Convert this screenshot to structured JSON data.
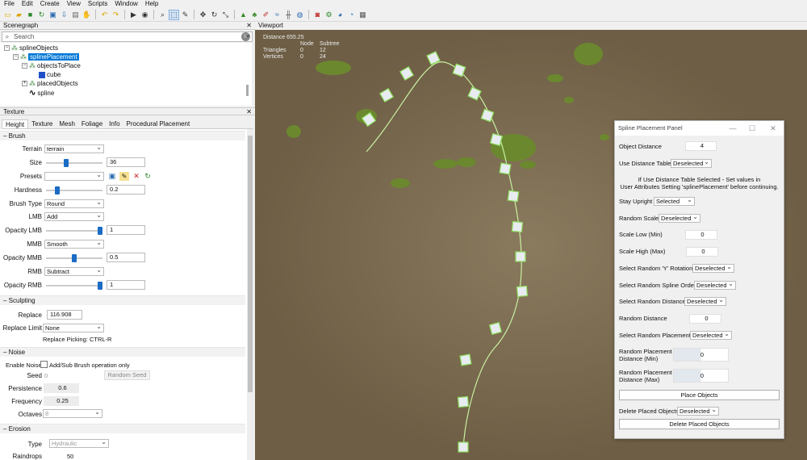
{
  "menu": [
    "File",
    "Edit",
    "Create",
    "View",
    "Scripts",
    "Window",
    "Help"
  ],
  "toolbar_icons": [
    "new-icon",
    "open-icon",
    "save-icon",
    "refresh-icon",
    "save-as-icon",
    "import-icon",
    "clipboard-icon",
    "hand-icon",
    "undo-icon",
    "redo-icon",
    "play-icon",
    "eye-icon",
    "zoom-icon",
    "select-icon",
    "paint-icon",
    "move-icon",
    "rotate-icon",
    "scale-icon",
    "terrain-icon",
    "tree-icon",
    "brush-icon",
    "water-icon",
    "road-icon",
    "globe-icon",
    "camera-icon",
    "gear-icon",
    "earth-icon",
    "snapshot-icon"
  ],
  "scenegraph": {
    "title": "Scenegraph",
    "search_placeholder": "Search",
    "nodes": {
      "root": "splineObjects",
      "placement": "splinePlacement",
      "objects_to_place": "objectsToPlace",
      "cube": "cube",
      "placed": "placedObjects",
      "spline": "spline"
    }
  },
  "texture": {
    "title": "Texture",
    "tabs": [
      "Height",
      "Texture",
      "Mesh",
      "Foliage",
      "Info",
      "Procedural Placement"
    ],
    "brush": {
      "heading": "Brush",
      "terrain_label": "Terrain",
      "terrain_value": "terrain",
      "size_label": "Size",
      "size_value": "36",
      "size_level": 0.35,
      "presets_label": "Presets",
      "hardness_label": "Hardness",
      "hardness_value": "0.2",
      "hardness_level": 0.2,
      "brush_type_label": "Brush Type",
      "brush_type_value": "Round",
      "lmb_label": "LMB",
      "lmb_value": "Add",
      "opacity_lmb_label": "Opacity LMB",
      "opacity_lmb_value": "1",
      "opacity_lmb_level": 1,
      "mmb_label": "MMB",
      "mmb_value": "Smooth",
      "opacity_mmb_label": "Opacity MMB",
      "opacity_mmb_value": "0.5",
      "opacity_mmb_level": 0.5,
      "rmb_label": "RMB",
      "rmb_value": "Subtract",
      "opacity_rmb_label": "Opacity RMB",
      "opacity_rmb_value": "1",
      "opacity_rmb_level": 1
    },
    "sculpting": {
      "heading": "Sculpting",
      "replace_label": "Replace",
      "replace_value": "116.908",
      "replace_limit_label": "Replace Limit",
      "replace_limit_value": "None",
      "picking_hint": "Replace Picking: CTRL-R"
    },
    "noise": {
      "heading": "Noise",
      "enable_label": "Enable Noise",
      "checkbox_label": "Add/Sub Brush operation only",
      "seed_label": "Seed",
      "seed_value": "0",
      "random_seed_button": "Random Seed",
      "persistence_label": "Persistence",
      "persistence_value": "0.6",
      "frequency_label": "Frequency",
      "frequency_value": "0.25",
      "octaves_label": "Octaves",
      "octaves_value": "8"
    },
    "erosion": {
      "heading": "Erosion",
      "type_label": "Type",
      "type_value": "Hydraulic",
      "raindrops_label": "Raindrops",
      "raindrops_value": "50"
    }
  },
  "viewport": {
    "title": "Viewport",
    "distance": "Distance 655.25",
    "col_node": "Node",
    "col_subtree": "Subtree",
    "triangles_label": "Triangles",
    "triangles_node": "0",
    "triangles_subtree": "12",
    "vertices_label": "Vertices",
    "vertices_node": "0",
    "vertices_subtree": "24"
  },
  "panel": {
    "title": "Spline Placement Panel",
    "object_distance_label": "Object Distance",
    "object_distance_value": "4",
    "use_distance_table_label": "Use Distance Table",
    "use_distance_table_value": "Deselected",
    "note_line1": "If Use Distance Table Selected - Set values in",
    "note_line2": "User Attributes Setting 'splinePlacement' before continuing.",
    "stay_upright_label": "Stay Upright",
    "stay_upright_value": "Selected",
    "random_scale_label": "Random Scale",
    "random_scale_value": "Deselected",
    "scale_low_label": "Scale Low (Min)",
    "scale_low_value": "0",
    "scale_high_label": "Scale High (Max)",
    "scale_high_value": "0",
    "random_y_label": "Select Random 'Y' Rotation",
    "random_y_value": "Deselected",
    "random_order_label": "Select Random Spline Order",
    "random_order_value": "Deselected",
    "random_distance_sel_label": "Select Random Distance",
    "random_distance_sel_value": "Deselected",
    "random_distance_label": "Random Distance",
    "random_distance_value": "0",
    "random_placement_label": "Select Random Placement",
    "random_placement_value": "Deselected",
    "rp_min_label1": "Random Placement",
    "rp_min_label2": "Distance (Min)",
    "rp_min_value": "0",
    "rp_max_label1": "Random Placement",
    "rp_max_label2": "Distance (Max)",
    "rp_max_value": "0",
    "place_button": "Place Objects",
    "delete_label": "Delete Placed Objects",
    "delete_value": "Deselected",
    "delete_button": "Delete Placed Objects"
  }
}
